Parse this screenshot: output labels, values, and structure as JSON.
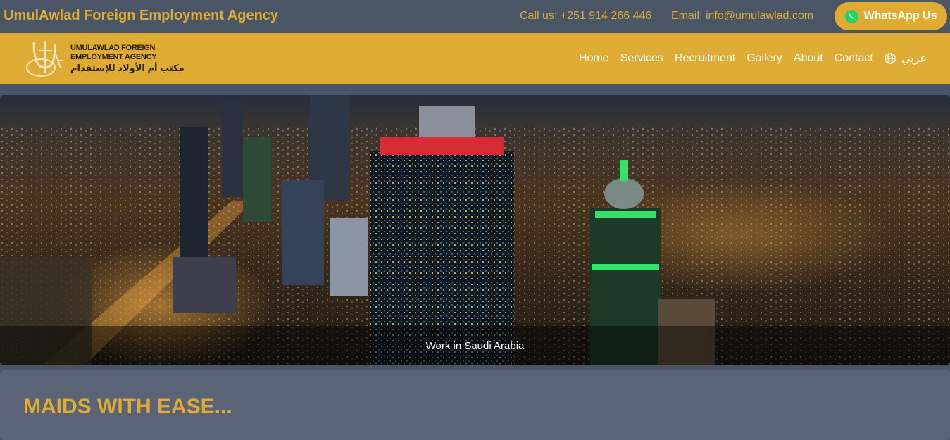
{
  "topbar": {
    "brand_title": "UmulAwlad Foreign Employment Agency",
    "call": "Call us: +251 914 266 446",
    "email": "Email: info@umulawlad.com",
    "whatsapp_label": "WhatsApp Us"
  },
  "logo": {
    "line1": "UMULAWLAD FOREIGN",
    "line2": "EMPLOYMENT AGENCY",
    "line3": "مكتب أم الأولاد للإستقدام"
  },
  "nav": {
    "items": [
      {
        "label": "Home"
      },
      {
        "label": "Services"
      },
      {
        "label": "Recruitment"
      },
      {
        "label": "Gallery"
      },
      {
        "label": "About"
      },
      {
        "label": "Contact"
      }
    ],
    "language": "عربي"
  },
  "hero": {
    "caption": "Work in Saudi Arabia"
  },
  "section": {
    "title": "MAIDS WITH EASE..."
  },
  "colors": {
    "accent": "#e0ab32",
    "navbar": "#deab35",
    "background": "#4a5566",
    "whatsapp": "#25d366"
  }
}
